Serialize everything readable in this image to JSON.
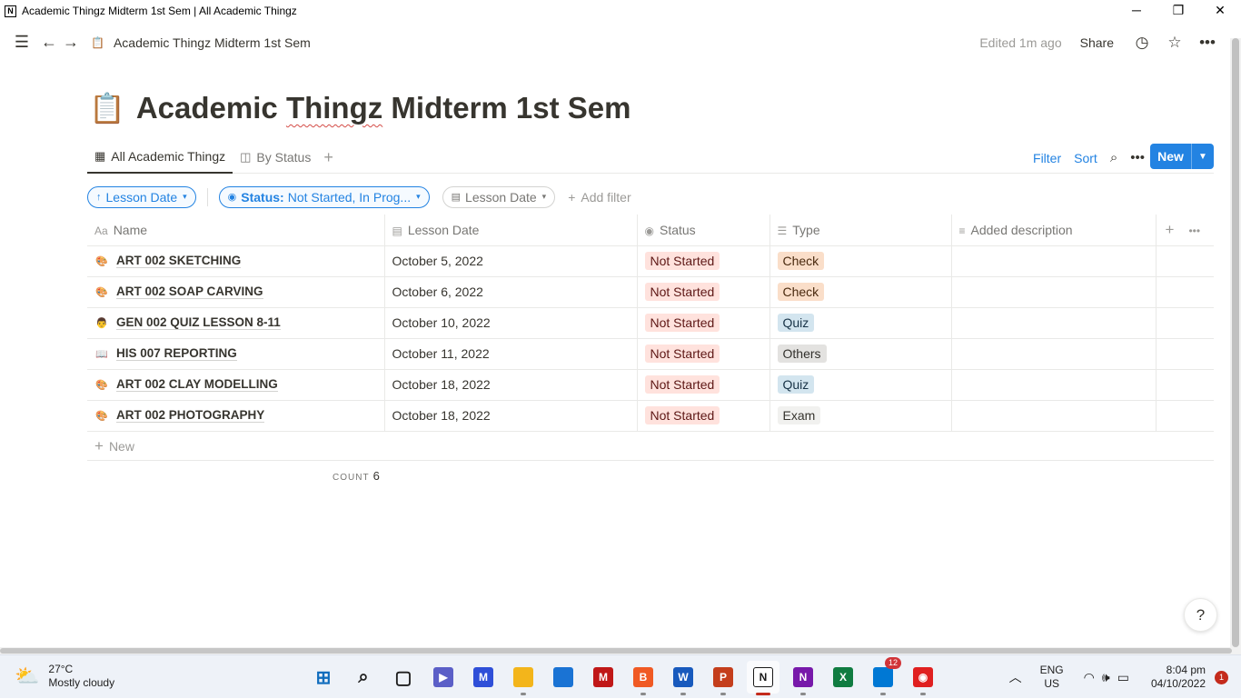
{
  "window": {
    "title": "Academic Thingz Midterm 1st Sem | All Academic Thingz",
    "app_logo": "N"
  },
  "topbar": {
    "breadcrumb": "Academic Thingz Midterm 1st Sem",
    "edited": "Edited 1m ago",
    "share": "Share"
  },
  "page": {
    "title_prefix": "Academic ",
    "title_squiggle": "Thingz",
    "title_suffix": " Midterm 1st Sem",
    "emoji": "📋"
  },
  "views": {
    "tabs": [
      {
        "label": "All Academic Thingz"
      },
      {
        "label": "By Status"
      }
    ],
    "filter": "Filter",
    "sort": "Sort",
    "new": "New"
  },
  "filters": {
    "sort_pill": "Lesson Date",
    "status_key": "Status:",
    "status_value": "Not Started, In Prog...",
    "date_pill": "Lesson Date",
    "add_filter": "Add filter"
  },
  "table": {
    "headers": {
      "name": "Name",
      "date": "Lesson Date",
      "status": "Status",
      "type": "Type",
      "desc": "Added description"
    },
    "rows": [
      {
        "icon": "🎨",
        "name": "ART 002 SKETCHING",
        "date": "October 5, 2022",
        "status": "Not Started",
        "type": "Check",
        "type_color": "orange"
      },
      {
        "icon": "🎨",
        "name": "ART 002 SOAP CARVING",
        "date": "October 6, 2022",
        "status": "Not Started",
        "type": "Check",
        "type_color": "orange"
      },
      {
        "icon": "👨",
        "name": "GEN 002 QUIZ LESSON 8-11",
        "date": "October 10, 2022",
        "status": "Not Started",
        "type": "Quiz",
        "type_color": "blue"
      },
      {
        "icon": "📖",
        "name": "HIS 007 REPORTING",
        "date": "October 11, 2022",
        "status": "Not Started",
        "type": "Others",
        "type_color": "gray"
      },
      {
        "icon": "🎨",
        "name": "ART 002 CLAY MODELLING",
        "date": "October 18, 2022",
        "status": "Not Started",
        "type": "Quiz",
        "type_color": "blue"
      },
      {
        "icon": "🎨",
        "name": "ART 002 PHOTOGRAPHY",
        "date": "October 18, 2022",
        "status": "Not Started",
        "type": "Exam",
        "type_color": "default"
      }
    ],
    "new_row": "New",
    "count_label": "COUNT",
    "count_value": "6"
  },
  "help": "?",
  "taskbar": {
    "weather_temp": "27°C",
    "weather_desc": "Mostly cloudy",
    "apps": [
      {
        "name": "start",
        "label": "⊞",
        "color": "#0f6cbd"
      },
      {
        "name": "search",
        "label": "⌕",
        "color": "#202020"
      },
      {
        "name": "task-view",
        "label": "▢",
        "color": "#202020"
      },
      {
        "name": "teams-chat",
        "label": "▶",
        "color": "#5b5fc7"
      },
      {
        "name": "tool-app",
        "label": "M",
        "color": "#2f4fd8"
      },
      {
        "name": "file-explorer",
        "label": "",
        "color": "#f3b51b"
      },
      {
        "name": "store",
        "label": "",
        "color": "#1a73d4"
      },
      {
        "name": "mcafee",
        "label": "M",
        "color": "#c01818"
      },
      {
        "name": "brave",
        "label": "B",
        "color": "#f05a24"
      },
      {
        "name": "word",
        "label": "W",
        "color": "#185abd"
      },
      {
        "name": "powerpoint",
        "label": "P",
        "color": "#c43e1c"
      },
      {
        "name": "notion",
        "label": "N",
        "color": "#191919"
      },
      {
        "name": "onenote",
        "label": "N",
        "color": "#7719aa"
      },
      {
        "name": "excel",
        "label": "X",
        "color": "#107c41"
      },
      {
        "name": "remote",
        "label": "",
        "color": "#0078d4",
        "badge": "12"
      },
      {
        "name": "recorder",
        "label": "◉",
        "color": "#e02020"
      }
    ],
    "lang": "ENG",
    "region": "US",
    "time": "8:04 pm",
    "date": "04/10/2022",
    "notif_count": "1"
  }
}
